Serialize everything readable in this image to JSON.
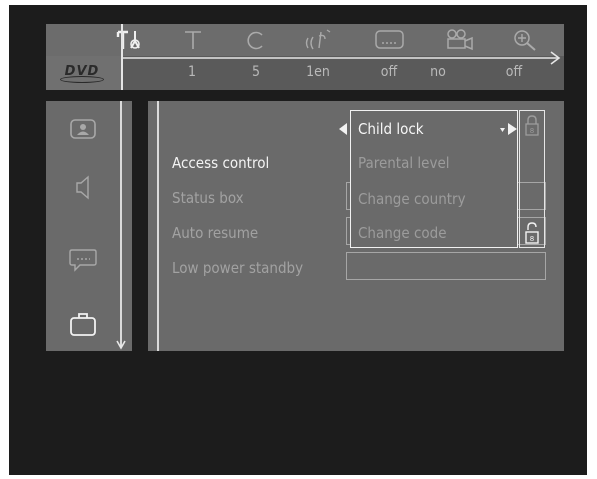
{
  "statusbar": {
    "icons": [
      "tools-icon",
      "title-icon",
      "chapter-icon",
      "audio-icon",
      "subtitle-icon",
      "angle-icon",
      "zoom-icon"
    ],
    "values": [
      "1",
      "5",
      "1en",
      "off",
      "no",
      "off"
    ],
    "logo_text": "DVD"
  },
  "sidebar": {
    "items": [
      {
        "icon": "picture-icon"
      },
      {
        "icon": "sound-icon"
      },
      {
        "icon": "language-icon"
      },
      {
        "icon": "features-icon"
      }
    ]
  },
  "menu": {
    "items": [
      {
        "label": "Access control",
        "active": true
      },
      {
        "label": "Status box",
        "active": false
      },
      {
        "label": "Auto resume",
        "active": false
      },
      {
        "label": "Low power standby",
        "active": false
      }
    ]
  },
  "submenu": {
    "items": [
      {
        "label": "Child lock",
        "active": true
      },
      {
        "label": "Parental level",
        "active": false
      },
      {
        "label": "Change country",
        "active": false
      },
      {
        "label": "Change code",
        "active": false
      }
    ]
  },
  "colors": {
    "screen_bg": "#1c1c1c",
    "panel_bg": "#6a6a6a",
    "active_text": "#f3f3f3",
    "inactive_text": "#a2a2a2"
  }
}
